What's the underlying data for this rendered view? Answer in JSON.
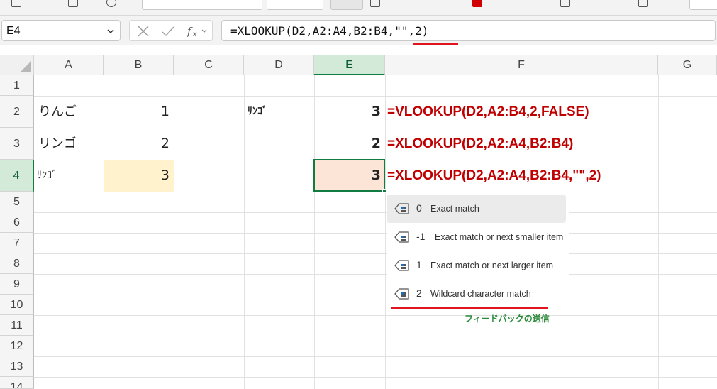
{
  "formula_bar": {
    "name_box": "E4",
    "formula": "=XLOOKUP(D2,A2:A4,B2:B4,\"\",2)"
  },
  "columns": [
    "A",
    "B",
    "C",
    "D",
    "E",
    "F",
    "G"
  ],
  "rows": [
    "1",
    "2",
    "3",
    "4",
    "5",
    "6",
    "7",
    "8",
    "9",
    "10",
    "11",
    "12",
    "13",
    "14"
  ],
  "selected_cell": "E4",
  "cells": {
    "A2": "りんご",
    "A3": "リンゴ",
    "A4": "ﾘﾝｺﾞ",
    "B2": "1",
    "B3": "2",
    "B4": "3",
    "D2": "ﾘﾝｺﾞ",
    "E2": "3",
    "E3": "2",
    "E4": "3"
  },
  "annotations": {
    "row2": "=VLOOKUP(D2,A2:B4,2,FALSE)",
    "row3": "=XLOOKUP(D2,A2:A4,B2:B4)",
    "row4": "=XLOOKUP(D2,A2:A4,B2:B4,\"\",2)"
  },
  "autocomplete": {
    "items": [
      {
        "code": "0",
        "label": "Exact match",
        "active": true
      },
      {
        "code": "-1",
        "label": "Exact match or next smaller item",
        "active": false
      },
      {
        "code": "1",
        "label": "Exact match or next larger item",
        "active": false
      },
      {
        "code": "2",
        "label": "Wildcard character match",
        "active": false
      }
    ],
    "feedback": "フィードバックの送信",
    "icon": "match-mode-icon"
  },
  "colors": {
    "accent_green": "#107c41",
    "annotation_red": "#c00000",
    "underline_red": "#e0141e",
    "b4_fill": "#fff2cc",
    "e4_fill": "#fce4d6"
  }
}
